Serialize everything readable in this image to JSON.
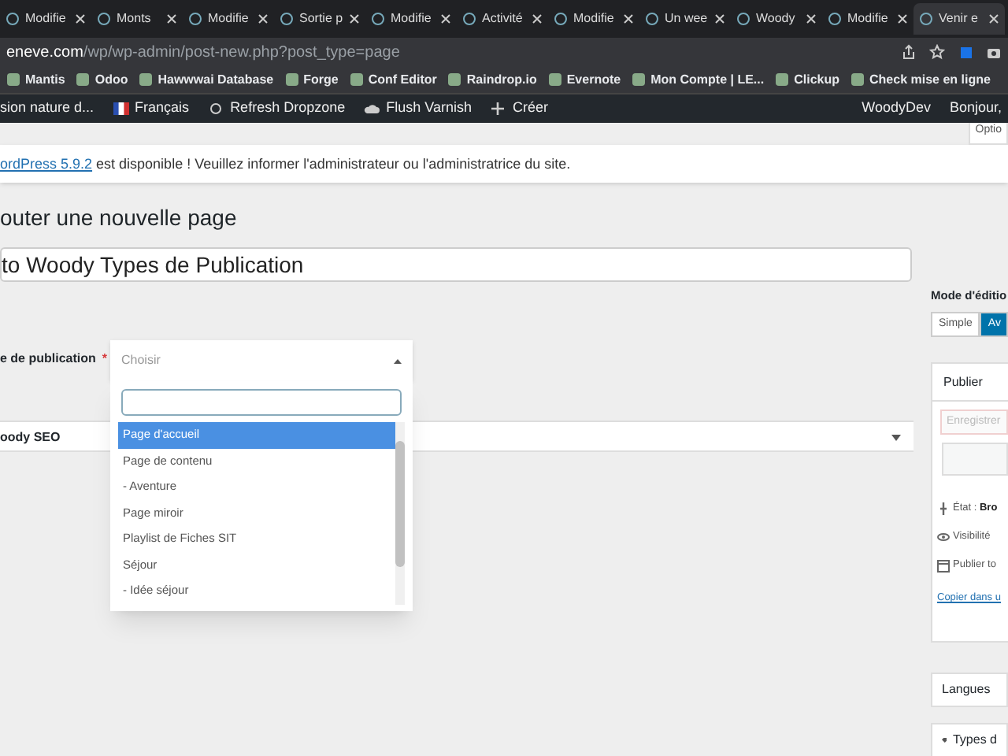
{
  "browser": {
    "tabs": [
      {
        "label": "Modifie",
        "selected": false
      },
      {
        "label": "Monts",
        "selected": false
      },
      {
        "label": "Modifie",
        "selected": false
      },
      {
        "label": "Sortie p",
        "selected": false
      },
      {
        "label": "Modifie",
        "selected": false
      },
      {
        "label": "Activité",
        "selected": false
      },
      {
        "label": "Modifie",
        "selected": false
      },
      {
        "label": "Un wee",
        "selected": false
      },
      {
        "label": "Woody",
        "selected": false
      },
      {
        "label": "Modifie",
        "selected": false
      },
      {
        "label": "Venir e",
        "selected": true
      }
    ],
    "address": {
      "host": "eneve.com",
      "path": "/wp/wp-admin/post-new.php?post_type=page"
    },
    "bookmarks": [
      "Mantis",
      "Odoo",
      "Hawwwai Database",
      "Forge",
      "Conf Editor",
      "Raindrop.io",
      "Evernote",
      "Mon Compte | LE...",
      "Clickup",
      "Check mise en ligne"
    ]
  },
  "admin_bar": {
    "items": [
      "sion nature d...",
      "Français",
      "Refresh Dropzone",
      "Flush Varnish",
      "Créer"
    ],
    "user": "WoodyDev",
    "greeting": "Bonjour,"
  },
  "screen_options": "Optio",
  "notice": {
    "link": "ordPress 5.9.2",
    "text": " est disponible ! Veuillez informer l'administrateur ou l'administratrice du site."
  },
  "heading": "outer une nouvelle page",
  "title_value": "to Woody Types de Publication",
  "type_field": {
    "label": "e de publication",
    "required": true,
    "required_mark": "*",
    "placeholder": "Choisir",
    "expanded": true,
    "options": [
      {
        "label": "Page d'accueil",
        "selected": true
      },
      {
        "label": "Page de contenu",
        "selected": false
      },
      {
        "label": "- Aventure",
        "selected": false
      },
      {
        "label": "Page miroir",
        "selected": false
      },
      {
        "label": "Playlist de Fiches SIT",
        "selected": false
      },
      {
        "label": "Séjour",
        "selected": false
      },
      {
        "label": "- Idée séjour",
        "selected": false
      }
    ]
  },
  "seo_panel": "oody SEO",
  "sidebar": {
    "mode_label": "Mode d'éditio",
    "modes": [
      {
        "label": "Simple",
        "selected": false
      },
      {
        "label": "Av",
        "selected": true
      }
    ],
    "publish": {
      "title": "Publier",
      "save": "Enregistrer",
      "rows": [
        {
          "kind": "pin",
          "label": "État : ",
          "value": "Bro"
        },
        {
          "kind": "eye",
          "label": "Visibilité"
        },
        {
          "kind": "calendar",
          "label": "Publier to"
        }
      ],
      "copy_link": "Copier dans u"
    },
    "boxes": [
      {
        "kind": "plain",
        "title": "Langues"
      },
      {
        "kind": "tag",
        "title": "Types d"
      }
    ]
  }
}
